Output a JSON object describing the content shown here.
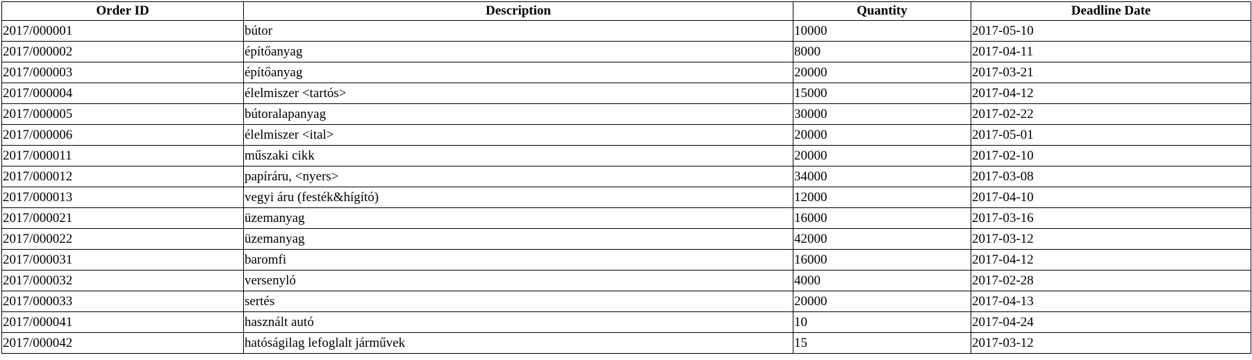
{
  "table": {
    "headers": {
      "order_id": "Order ID",
      "description": "Description",
      "quantity": "Quantity",
      "deadline": "Deadline Date"
    },
    "rows": [
      {
        "order_id": "2017/000001",
        "description": "bútor",
        "quantity": "10000",
        "deadline": "2017-05-10"
      },
      {
        "order_id": "2017/000002",
        "description": "építőanyag",
        "quantity": "8000",
        "deadline": "2017-04-11"
      },
      {
        "order_id": "2017/000003",
        "description": "építőanyag",
        "quantity": "20000",
        "deadline": "2017-03-21"
      },
      {
        "order_id": "2017/000004",
        "description": "élelmiszer <tartós>",
        "quantity": "15000",
        "deadline": "2017-04-12"
      },
      {
        "order_id": "2017/000005",
        "description": "bútoralapanyag",
        "quantity": "30000",
        "deadline": "2017-02-22"
      },
      {
        "order_id": "2017/000006",
        "description": "élelmiszer <ital>",
        "quantity": "20000",
        "deadline": "2017-05-01"
      },
      {
        "order_id": "2017/000011",
        "description": "műszaki cikk",
        "quantity": "20000",
        "deadline": "2017-02-10"
      },
      {
        "order_id": "2017/000012",
        "description": "papíráru, <nyers>",
        "quantity": "34000",
        "deadline": "2017-03-08"
      },
      {
        "order_id": "2017/000013",
        "description": "vegyi áru (festék&hígító)",
        "quantity": "12000",
        "deadline": "2017-04-10"
      },
      {
        "order_id": "2017/000021",
        "description": "üzemanyag",
        "quantity": "16000",
        "deadline": "2017-03-16"
      },
      {
        "order_id": "2017/000022",
        "description": "üzemanyag",
        "quantity": "42000",
        "deadline": "2017-03-12"
      },
      {
        "order_id": "2017/000031",
        "description": "baromfi",
        "quantity": "16000",
        "deadline": "2017-04-12"
      },
      {
        "order_id": "2017/000032",
        "description": "versenyló",
        "quantity": "4000",
        "deadline": "2017-02-28"
      },
      {
        "order_id": "2017/000033",
        "description": "sertés",
        "quantity": "20000",
        "deadline": "2017-04-13"
      },
      {
        "order_id": "2017/000041",
        "description": "használt autó",
        "quantity": "10",
        "deadline": "2017-04-24"
      },
      {
        "order_id": "2017/000042",
        "description": "hatóságilag lefoglalt járművek",
        "quantity": "15",
        "deadline": "2017-03-12"
      }
    ]
  }
}
